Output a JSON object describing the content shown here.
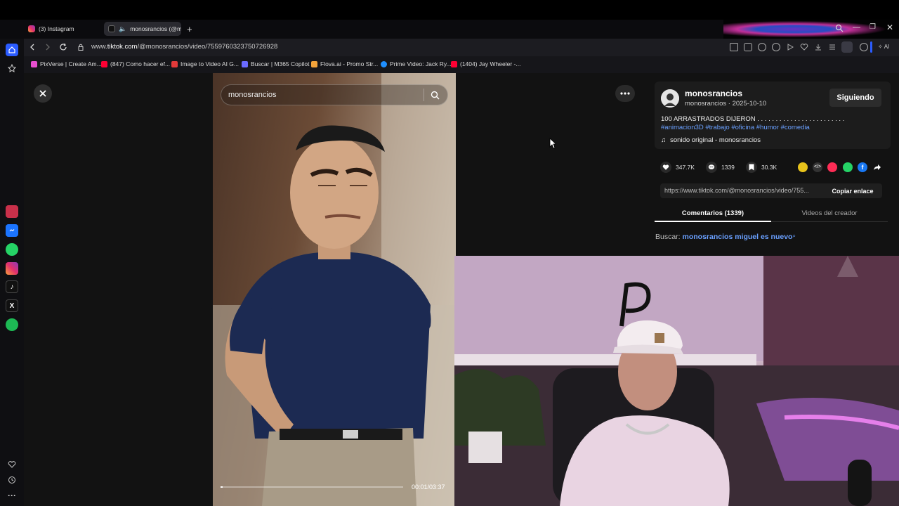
{
  "browser": {
    "tabs": [
      {
        "label": "(3) Instagram",
        "active": false
      },
      {
        "label": "monosrancios (@mon",
        "active": true
      }
    ],
    "url_prefix": "www.",
    "url_host": "tiktok.com",
    "url_path": "/@monosrancios/video/7559760323750726928",
    "ai_label": "AI"
  },
  "bookmarks": [
    {
      "label": "PixVerse | Create Am...",
      "color": "#e84fd0"
    },
    {
      "label": "(847) Como hacer ef...",
      "color": "#ff0033"
    },
    {
      "label": "Image to Video AI G...",
      "color": "#e33a3a"
    },
    {
      "label": "Buscar | M365 Copilot",
      "color": "#6b6bff"
    },
    {
      "label": "Flova.ai - Promo Str...",
      "color": "#f2a33a"
    },
    {
      "label": "Prime Video: Jack Ry...",
      "color": "#1f8fff"
    },
    {
      "label": "(1404) Jay Wheeler -...",
      "color": "#ff0033"
    }
  ],
  "video": {
    "search_value": "monosrancios",
    "time": "00:01/03:37",
    "progress": 0.01
  },
  "creator": {
    "username": "monosrancios",
    "subline": "monosrancios · 2025-10-10",
    "follow_label": "Siguiendo",
    "description_text": "100 ARRASTRADOS DIJERON . . . . . . . . . . . . . . . . . . . . . . . .",
    "tag1": "#animacion3D",
    "tag2": "#trabajo",
    "tag3": "#oficina",
    "tag4": "#humor",
    "tag5": "#comedia",
    "sound": "sonido original - monosrancios"
  },
  "stats": {
    "likes": "347.7K",
    "comments": "1339",
    "saves": "30.3K"
  },
  "share": {
    "link": "https://www.tiktok.com/@monosrancios/video/755...",
    "copy_label": "Copiar enlace"
  },
  "panel_tabs": {
    "comments": "Comentarios (1339)",
    "videos": "Videos del creador"
  },
  "search_suggest": {
    "prefix": "Buscar: ",
    "query": "monosrancios miguel es nuevo"
  },
  "colors": {
    "link_accent": "#6aa0ff",
    "opera_red": "#ff1b2d"
  }
}
